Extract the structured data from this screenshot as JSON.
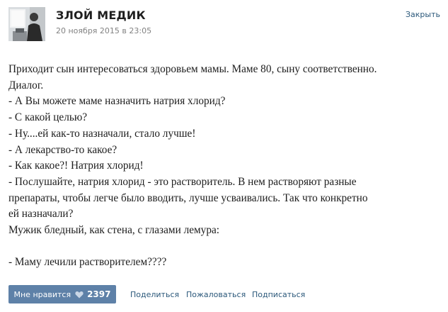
{
  "header": {
    "title": "ЗЛОЙ МЕДИК",
    "date": "20 ноября 2015 в 23:05",
    "close_label": "Закрыть"
  },
  "post": {
    "lines": [
      "Приходит сын интересоваться здоровьем мамы. Маме 80, сыну соответственно.",
      "Диалог.",
      "- А Вы можете маме назначить натрия хлорид?",
      "- С какой целью?",
      "- Ну....ей как-то назначали, стало лучше!",
      "- А лекарство-то какое?",
      "- Как какое?! Натрия хлорид!",
      "- Послушайте, натрия хлорид - это растворитель. В нем растворяют разные",
      "препараты, чтобы легче было вводить, лучше усваивались. Так что конкретно",
      "ей назначали?",
      "Мужик бледный, как стена, с глазами лемура:",
      "",
      "- Маму лечили растворителем????"
    ]
  },
  "footer": {
    "like_label": "Мне нравится",
    "like_icon": "heart-icon",
    "like_count": "2397",
    "share_label": "Поделиться",
    "report_label": "Пожаловаться",
    "subscribe_label": "Подписаться"
  },
  "colors": {
    "accent_link": "#2b587a",
    "like_button": "#5e81a8",
    "muted_text": "#828282"
  }
}
